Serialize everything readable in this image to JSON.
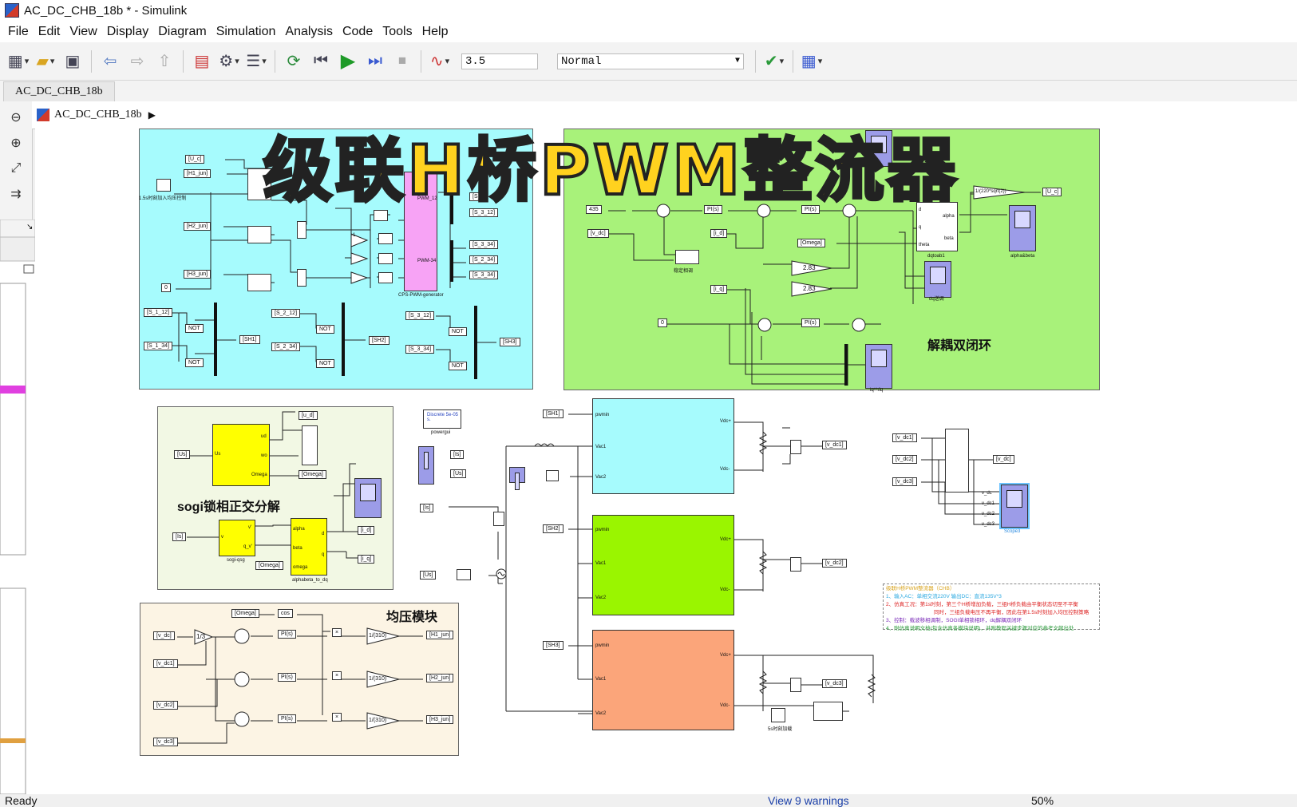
{
  "window": {
    "title": "AC_DC_CHB_18b * - Simulink"
  },
  "menu": [
    "File",
    "Edit",
    "View",
    "Display",
    "Diagram",
    "Simulation",
    "Analysis",
    "Code",
    "Tools",
    "Help"
  ],
  "toolbar": {
    "stop_time": "3.5",
    "sim_mode": "Normal"
  },
  "tab": {
    "label": "AC_DC_CHB_18b"
  },
  "breadcrumb": {
    "model": "AC_DC_CHB_18b"
  },
  "overlay": {
    "title": "级联H桥PWM整流器"
  },
  "subsystems": {
    "decoupling": "解耦双闭环",
    "sogi": "sogi锁相正交分解",
    "balance": "均压模块"
  },
  "modulation": {
    "tags_left": [
      "[U_c]",
      "[H1_jun]",
      "[H2_jun]",
      "[H3_jun]"
    ],
    "step_label": "1.5s时刻加入均压控制",
    "constant": "0",
    "pwm_block": "CPS-PWM-generator",
    "pwm_ports": [
      "PWM_12",
      "PWM-34"
    ],
    "outs_top": [
      "[S_2",
      "[S_3_12]",
      "[S_3_34]",
      "[S_2_34]",
      "[S_3_34]"
    ],
    "from_s": [
      "[S_1_12]",
      "[S_1_34]",
      "[S_2_12]",
      "[S_2_34]",
      "[S_3_12]",
      "[S_3_34]"
    ],
    "goto_sh": [
      "[SH1]",
      "[SH2]",
      "[SH3]"
    ],
    "not": "NOT",
    "gain": "-1"
  },
  "decoupling_blocks": {
    "const435": "435",
    "vdc": "[v_dc]",
    "id": "[i_d]",
    "iq": "[i_q]",
    "omega": "[Omega]",
    "pi": "PI(s)",
    "gain283": "2.83",
    "const0": "0",
    "dq": "dqtoab1",
    "uc_expr": "1/(220*sqrt(2))",
    "uc_tag": "[U_c]",
    "scope_ab": "alpha&beta",
    "scope_dq": "dq送调",
    "scope_v": "稳定相调",
    "scope_last": "iq^*/iq",
    "ports": {
      "d": "d",
      "q": "q",
      "theta": "theta",
      "alpha": "alpha",
      "beta": "beta"
    }
  },
  "sogi_blocks": {
    "us": "[Us]",
    "is": "[Is]",
    "ud": "[u_d]",
    "omega": "[Omega]",
    "id": "[i_d]",
    "iq": "[i_q]",
    "pll": "sogi-qsg",
    "ab2dq": "alphabeta_to_dq",
    "ports": [
      "Us",
      "ud",
      "wo",
      "Omega",
      "v",
      "v'",
      "q_v'",
      "alpha",
      "beta",
      "omega",
      "d",
      "q"
    ]
  },
  "balance_blocks": {
    "omega": "[Omega]",
    "cos": "cos",
    "vdc": "[v_dc]",
    "vdc1": "[v_dc1]",
    "vdc2": "[v_dc2]",
    "vdc3": "[v_dc3]",
    "div": "1/3",
    "pi": "PI(s)",
    "gain": "1/(310)",
    "h1": "[H1_jun]",
    "h2": "[H2_jun]",
    "h3": "[H3_jun]",
    "mul": "×"
  },
  "power_circuit": {
    "powergui": "Discrete 5e-05 s.",
    "powergui_name": "powergui",
    "sh1": "[SH1]",
    "sh2": "[SH2]",
    "sh3": "[SH3]",
    "is": "[Is]",
    "us": "[Us]",
    "ports": [
      "pwmin",
      "Vac1",
      "Vac2",
      "Vdc+",
      "Vdc-"
    ],
    "vdc_tags": [
      "[v_dc1]",
      "[v_dc2]",
      "[v_dc3]"
    ],
    "step_label": "5s时刻加载",
    "mux_in": [
      "[v_dc1]",
      "[v_dc2]",
      "[v_dc3]"
    ],
    "mux_out": "[v_dc]",
    "scope_ports": [
      "v_dc",
      "v_dc1",
      "v_dc2",
      "v_dc3"
    ],
    "scope_name": "Scope3"
  },
  "notes": {
    "title": "级联H桥PWM整流器（CHB）",
    "l1": "1、输入AC：单相交流220V  输出DC：直流135V*3",
    "l2": "2、仿真工况：第1s时刻，第三个H桥增加负载，三组H桥负载由平衡状态切至不平衡",
    "l2b": "同时，三组负载电压不再平衡，因此在第1.5s时刻加入均压控制策略",
    "l3": "3、控制：载波移相调制，SOGI单相锁相环，dq解耦双闭环",
    "l4": "4、附仿真说明文档(包含仿真各模块说明)，并附教程关键步骤对应的参考文献出处"
  },
  "status": {
    "left": "Ready",
    "warnings": "View 9 warnings",
    "zoom": "50%"
  },
  "colors": {
    "cyan": "#a6fbfd",
    "green": "#a8f27a",
    "yellow": "#ffff00",
    "salmon": "#fba57a",
    "lime": "#9af500",
    "pink": "#f7a3f5"
  }
}
